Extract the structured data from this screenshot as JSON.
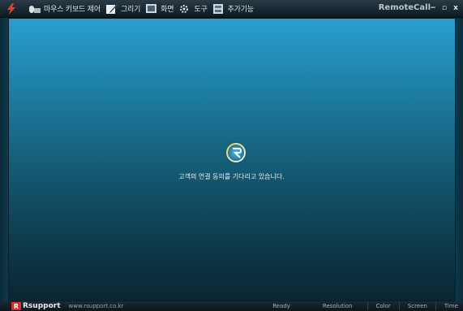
{
  "toolbar": {
    "items": [
      {
        "label": "",
        "icon": "lightning-icon"
      },
      {
        "label": "마우스 키보드 제어",
        "icon": "mouse-keyboard-icon"
      },
      {
        "label": "그리기",
        "icon": "pencil-icon"
      },
      {
        "label": "화면",
        "icon": "screen-icon"
      },
      {
        "label": "도구",
        "icon": "tools-icon"
      },
      {
        "label": "추가기능",
        "icon": "addon-icon"
      }
    ],
    "brand": "RemoteCall",
    "minimize": "−",
    "restore": "▫",
    "close": "x"
  },
  "main": {
    "message": "고객의 연결 동의를 기다리고 있습니다."
  },
  "statusbar": {
    "logo_badge": "R",
    "logo_text": "Rsupport",
    "site": "www.rsupport.co.kr",
    "fields": [
      "Ready",
      "Resolution",
      "Color",
      "Screen",
      "Time"
    ]
  },
  "colors": {
    "accent": "#2a9fcf",
    "logo": "#d1332b"
  }
}
